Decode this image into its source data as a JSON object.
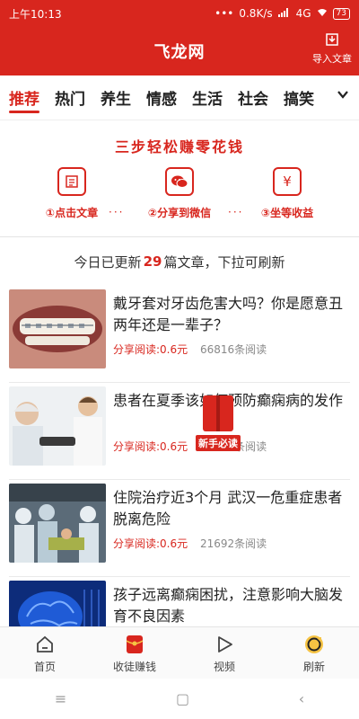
{
  "status_bar": {
    "time": "上午10:13",
    "net_speed": "0.8K/s",
    "network": "4G",
    "battery": "73"
  },
  "header": {
    "title": "飞龙网",
    "import_label": "导入文章"
  },
  "tabs": [
    "推荐",
    "热门",
    "养生",
    "情感",
    "生活",
    "社会",
    "搞笑"
  ],
  "promo": {
    "title": "三步轻松赚零花钱",
    "steps": [
      {
        "icon": "article-icon",
        "label": "①点击文章"
      },
      {
        "icon": "wechat-icon",
        "label": "②分享到微信"
      },
      {
        "icon": "yuan-icon",
        "label": "③坐等收益"
      }
    ],
    "separator": "···"
  },
  "refresh_notice": {
    "prefix": "今日已更新",
    "count": "29",
    "suffix": "篇文章，下拉可刷新"
  },
  "articles": [
    {
      "title": "戴牙套对牙齿危害大吗？你是愿意丑两年还是一辈子？",
      "earn": "分享阅读:0.6元",
      "reads": "66816条阅读"
    },
    {
      "title": "患者在夏季该如何预防癫痫病的发作",
      "earn": "分享阅读:0.6元",
      "reads": "85165条阅读"
    },
    {
      "title": "住院治疗近3个月 武汉一危重症患者脱离危险",
      "earn": "分享阅读:0.6元",
      "reads": "21692条阅读"
    },
    {
      "title": "孩子远离癫痫困扰，注意影响大脑发育不良因素",
      "earn": "",
      "reads": ""
    }
  ],
  "new_user_badge": "新手必读",
  "bottom_nav": [
    {
      "label": "首页",
      "icon": "home-icon"
    },
    {
      "label": "收徒赚钱",
      "icon": "red-envelope-icon"
    },
    {
      "label": "视频",
      "icon": "play-icon"
    },
    {
      "label": "刷新",
      "icon": "refresh-icon"
    }
  ],
  "system_nav": {
    "menu": "≡",
    "home": "▢",
    "back": "‹"
  },
  "colors": {
    "brand_red": "#d8261e"
  }
}
